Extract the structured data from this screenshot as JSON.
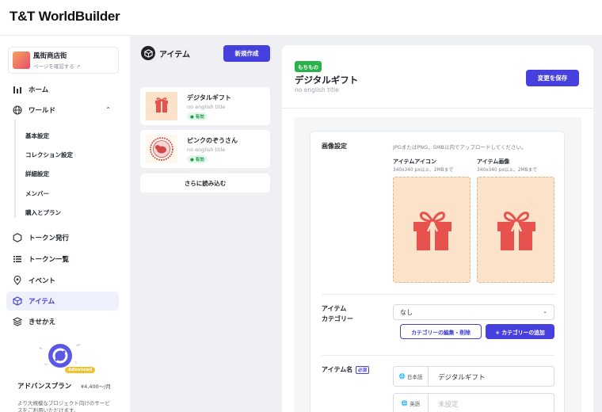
{
  "app": {
    "logo": "T&T WorldBuilder"
  },
  "shop": {
    "name": "風街商店街",
    "link": "ページを確認する ↗"
  },
  "nav": {
    "home": "ホーム",
    "world": "ワールド",
    "sub": [
      "基本設定",
      "コレクション設定",
      "詳細設定",
      "メンバー",
      "購入とプラン"
    ],
    "token_issue": "トークン発行",
    "token_list": "トークン一覧",
    "event": "イベント",
    "item": "アイテム",
    "dressup": "きせかえ"
  },
  "promo": {
    "badge": "Advanced",
    "title": "アドバンスプラン",
    "price": "¥4,400〜/月",
    "desc": "より大規模なプロジェクト向けのサービスをご利用いただけます。"
  },
  "list": {
    "title": "アイテム",
    "new_button": "新規作成",
    "items": [
      {
        "name": "デジタルギフト",
        "sub": "no english title",
        "status": "有効"
      },
      {
        "name": "ピンクのぞうさん",
        "sub": "no english title",
        "status": "有効"
      }
    ],
    "load_more": "さらに読み込む"
  },
  "detail": {
    "tag": "もちもの",
    "title": "デジタルギフト",
    "subtitle": "no english title",
    "save_button": "変更を保存"
  },
  "form": {
    "image_label": "画像設定",
    "image_hint": "JPGまたはPNG、5MB以内でアップロードしてください。",
    "icon_label": "アイテムアイコン",
    "icon_sub": "340x340 px以上、2MBまで",
    "image2_label": "アイテム画像",
    "image2_sub": "340x340 px以上、2MBまで",
    "category_label": "アイテム\nカテゴリー",
    "category_value": "なし",
    "edit_category": "カテゴリーの編集・削除",
    "add_category": "+ カテゴリーの追加",
    "name_label": "アイテム名",
    "required": "必須",
    "lang_ja": "日本語",
    "name_ja": "デジタルギフト",
    "lang_en": "英語",
    "name_en_placeholder": "未設定"
  },
  "colors": {
    "accent": "#4640de",
    "gift": "#e8524e",
    "gift_bg": "#fbe2c8",
    "active": "#2bb24c"
  }
}
